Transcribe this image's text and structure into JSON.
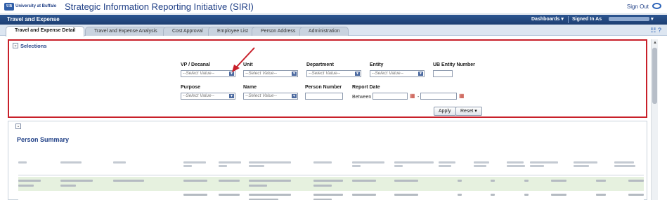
{
  "header": {
    "logo_text": "University at Buffalo",
    "logo_mark": "UB",
    "title": "Strategic Information Reporting Initiative (SIRI)",
    "sign_out": "Sign Out",
    "sign_out_icon": "sign-out-icon"
  },
  "dashbar": {
    "title": "Travel and Expense",
    "dashboards": "Dashboards ▾",
    "signed_in": "Signed In As"
  },
  "tabs": [
    {
      "label": "Travel and Expense Detail",
      "active": true
    },
    {
      "label": "Travel and Expense Analysis",
      "active": false
    },
    {
      "label": "Cost Approval",
      "active": false
    },
    {
      "label": "Employee List",
      "active": false
    },
    {
      "label": "Person Address",
      "active": false
    },
    {
      "label": "Administration",
      "active": false
    }
  ],
  "selections": {
    "title": "Selections",
    "fields": {
      "vp": {
        "label": "VP / Decanal",
        "value": "--Select Value--"
      },
      "unit": {
        "label": "Unit",
        "value": "--Select Value--"
      },
      "department": {
        "label": "Department",
        "value": "--Select Value--"
      },
      "entity": {
        "label": "Entity",
        "value": "--Select Value--"
      },
      "ub_entity_number": {
        "label": "UB Entity Number",
        "value": ""
      },
      "purpose": {
        "label": "Purpose",
        "value": "--Select Value--"
      },
      "name": {
        "label": "Name",
        "value": "--Select Value--"
      },
      "person_number": {
        "label": "Person Number",
        "value": ""
      },
      "report_date": {
        "label": "Report Date",
        "between": "Between",
        "separator": "-"
      }
    },
    "apply": "Apply",
    "reset": "Reset ▾"
  },
  "summary": {
    "title": "Person Summary"
  },
  "colors": {
    "brand": "#1f3f86",
    "annotation": "#c8202a",
    "row_highlight": "#e6f1df"
  }
}
